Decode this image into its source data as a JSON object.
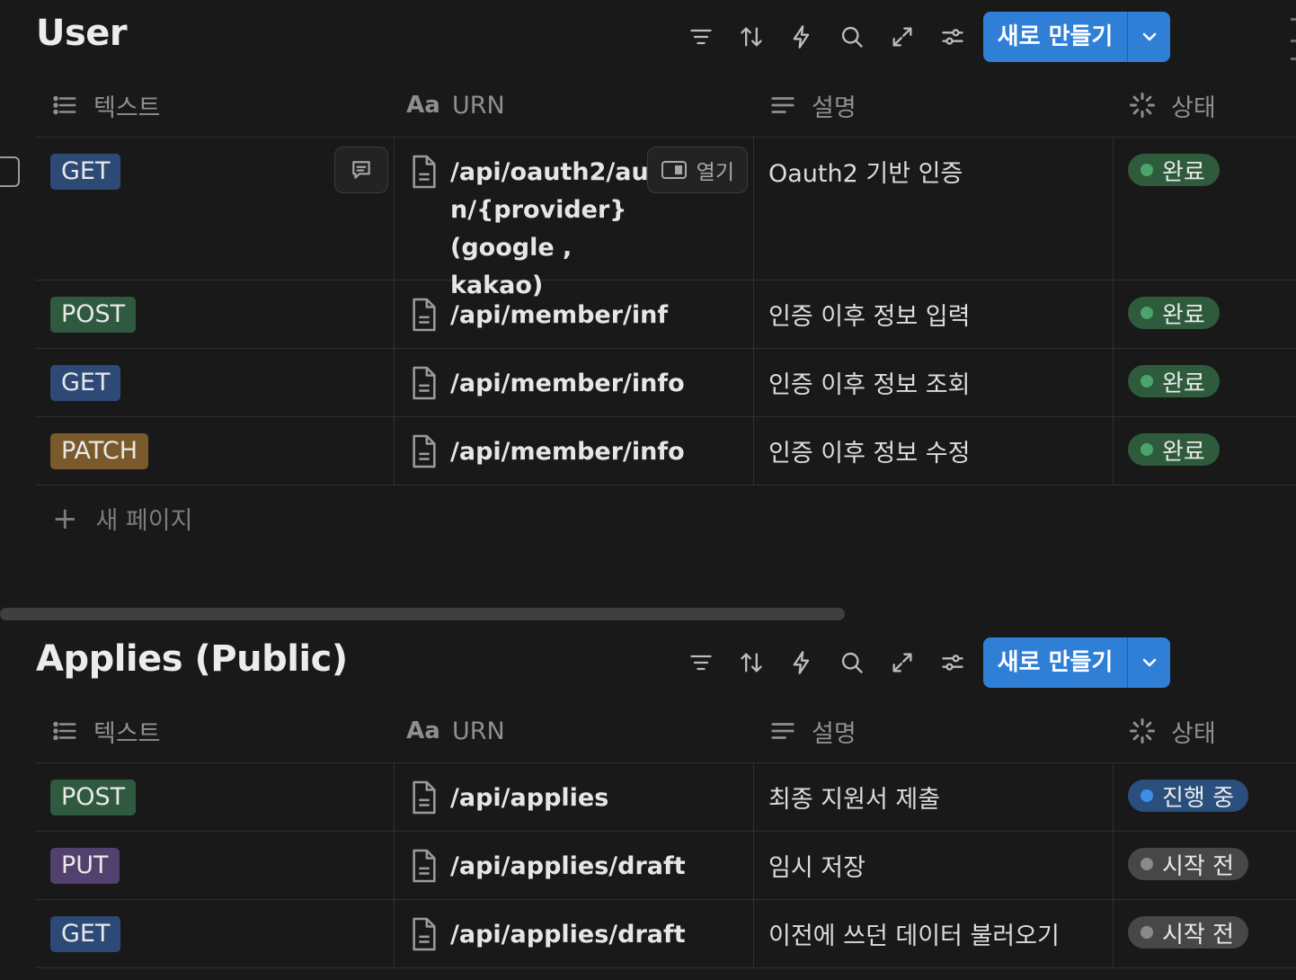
{
  "toolbar_icons": [
    "filter-icon",
    "sort-icon",
    "automation-icon",
    "search-icon",
    "expand-icon",
    "settings-icon"
  ],
  "colors": {
    "accent": "#2f7fd7",
    "get": "#2d4a76",
    "post": "#2f5a3f",
    "patch": "#7a5a2a",
    "put": "#52406e"
  },
  "columns": {
    "text": "텍스트",
    "urn": "URN",
    "desc": "설명",
    "status": "상태"
  },
  "new_button": "새로 만들기",
  "user": {
    "title": "User",
    "open_label": "열기",
    "new_page": "새 페이지",
    "rows": [
      {
        "method": "GET",
        "urn": "/api/oauth2/authn/{provider} (google , kakao)",
        "urn_lines": [
          "/api/oauth2/auth",
          "n/{provider} (google ,",
          "kakao)"
        ],
        "desc": "Oauth2 기반 인증",
        "status": "완료"
      },
      {
        "method": "POST",
        "urn": "/api/member/inf",
        "desc": "인증 이후 정보 입력",
        "status": "완료"
      },
      {
        "method": "GET",
        "urn": "/api/member/info",
        "desc": "인증 이후 정보 조회",
        "status": "완료"
      },
      {
        "method": "PATCH",
        "urn": "/api/member/info",
        "desc": "인증 이후 정보 수정",
        "status": "완료"
      }
    ]
  },
  "applies": {
    "title": "Applies (Public)",
    "rows": [
      {
        "method": "POST",
        "urn": "/api/applies",
        "desc": "최종 지원서 제출",
        "status": "진행 중"
      },
      {
        "method": "PUT",
        "urn": "/api/applies/draft",
        "desc": "임시 저장",
        "status": "시작 전"
      },
      {
        "method": "GET",
        "urn": "/api/applies/draft",
        "desc": "이전에 쓰던 데이터 불러오기",
        "status": "시작 전"
      }
    ]
  }
}
